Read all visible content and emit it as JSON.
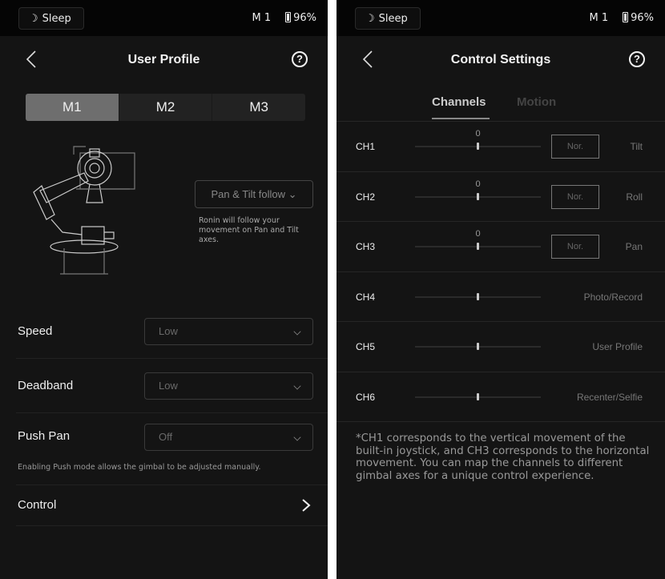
{
  "status_bar": {
    "sleep_label": "Sleep",
    "mode": "M 1",
    "battery": "96%",
    "sleep_icon": "moon-icon",
    "battery_icon": "battery-icon"
  },
  "user_profile": {
    "title": "User Profile",
    "profiles": [
      {
        "label": "M1",
        "active": true
      },
      {
        "label": "M2",
        "active": false
      },
      {
        "label": "M3",
        "active": false
      }
    ],
    "follow_mode": "Pan & Tilt follow",
    "follow_description": "Ronin will follow your movement on Pan and Tilt axes.",
    "settings": [
      {
        "label": "Speed",
        "value": "Low"
      },
      {
        "label": "Deadband",
        "value": "Low"
      },
      {
        "label": "Push Pan",
        "value": "Off"
      }
    ],
    "push_note": "Enabling Push mode allows the gimbal to be adjusted manually.",
    "control_label": "Control"
  },
  "control_settings": {
    "title": "Control Settings",
    "tabs": [
      {
        "label": "Channels",
        "active": true
      },
      {
        "label": "Motion",
        "active": false
      }
    ],
    "channels": [
      {
        "name": "CH1",
        "value": "0",
        "position": 0.5,
        "mode": "Nor.",
        "axis": "Tilt"
      },
      {
        "name": "CH2",
        "value": "0",
        "position": 0.5,
        "mode": "Nor.",
        "axis": "Roll"
      },
      {
        "name": "CH3",
        "value": "0",
        "position": 0.5,
        "mode": "Nor.",
        "axis": "Pan"
      },
      {
        "name": "CH4",
        "position": 0.5,
        "axis": "Photo/Record"
      },
      {
        "name": "CH5",
        "position": 0.5,
        "axis": "User Profile"
      },
      {
        "name": "CH6",
        "position": 0.5,
        "axis": "Recenter/Selfie"
      }
    ],
    "footnote": "*CH1 corresponds to the vertical movement of the built-in joystick, and CH3 corresponds to the horizontal movement. You can map the channels to different gimbal axes for a unique control experience."
  }
}
